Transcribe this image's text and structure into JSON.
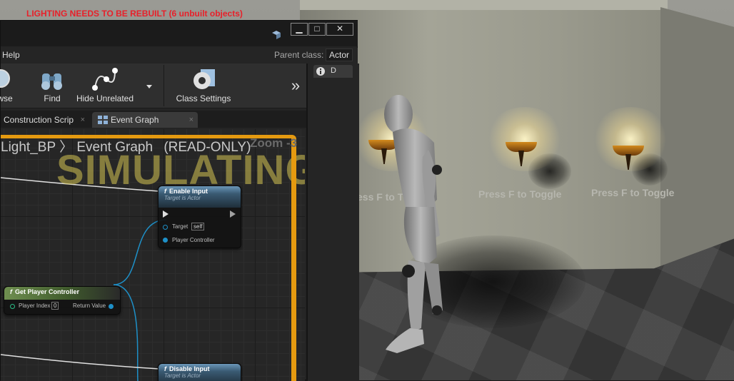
{
  "warning": {
    "lighting": "LIGHTING NEEDS TO BE REBUILT (6 unbuilt objects)"
  },
  "viewport": {
    "toggle_texts": [
      "ess F to T",
      "Press F to Toggle",
      "Press F to Toggle"
    ]
  },
  "window": {
    "buttons": {
      "minimize": "▁",
      "maximize": "□",
      "close": "✕"
    },
    "menu": {
      "help": "Help"
    },
    "parent_class": {
      "label": "Parent class:",
      "value": "Actor"
    }
  },
  "toolbar": {
    "items": [
      {
        "label": "wse",
        "icon": "browse-icon"
      },
      {
        "label": "Find",
        "icon": "binoculars-icon"
      },
      {
        "label": "Hide Unrelated",
        "icon": "hide-unrelated-icon"
      },
      {
        "label": "Class Settings",
        "icon": "class-settings-icon"
      }
    ],
    "overflow": "»"
  },
  "details_tab": {
    "label": "D",
    "icon": "info-icon"
  },
  "tabs": [
    {
      "label": "Construction Scrip",
      "close": "×",
      "active": false
    },
    {
      "label": "Event Graph",
      "close": "×",
      "active": true
    }
  ],
  "graph": {
    "breadcrumb": {
      "parent": "Light_BP",
      "sep": "〉",
      "current": "Event Graph",
      "mode": "(READ-ONLY)"
    },
    "zoom": "Zoom -3",
    "watermark": "SIMULATING",
    "nodes": {
      "enable_input": {
        "title": "Enable Input",
        "subtitle": "Target is Actor",
        "target_label": "Target",
        "target_value": "self",
        "pc_label": "Player Controller"
      },
      "get_player_controller": {
        "title": "Get Player Controller",
        "index_label": "Player Index",
        "index_value": "0",
        "return_label": "Return Value"
      },
      "disable_input": {
        "title": "Disable Input",
        "subtitle": "Target is Actor"
      }
    },
    "function_glyph": "f"
  },
  "colors": {
    "accent": "#e59a10",
    "pin": "#1e90c8",
    "warning": "#e8202a"
  }
}
